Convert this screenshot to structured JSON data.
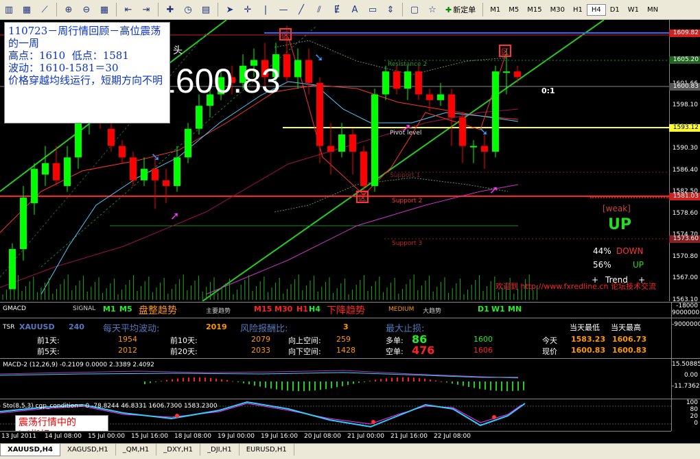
{
  "toolbar": {
    "new_order": "新定单",
    "timeframes": [
      "M1",
      "M5",
      "M15",
      "M30",
      "H1",
      "H4",
      "D1",
      "W1",
      "MN"
    ],
    "active_tf": "H4"
  },
  "note": {
    "text": "110723－周行情回顾－高位震荡的一周\n高点：1610  低点：1581\n波动：1610-1581＝30\n价格穿越均线运行，短期方向不明"
  },
  "chart": {
    "big_price": "1600.83",
    "big_prefix_glyph": "头",
    "ratio": "0:1",
    "levels": {
      "resistance2": "Resistance 2",
      "pivot": "Pivot level",
      "support1": "Support 1",
      "support2": "Support 2",
      "support3": "Support 3"
    },
    "axis_ticks": [
      "1605.20",
      "1601.66",
      "1598.10",
      "1594.20",
      "1590.30",
      "1586.40",
      "1582.50",
      "1578.60",
      "1574.70",
      "1570.80",
      "1567.00",
      "1563.10"
    ],
    "tags": {
      "t1": "1609.82",
      "t2": "1605.20",
      "t3": "1600.83",
      "t4": "1593.12",
      "t5": "1581.03",
      "t6": "1573.60"
    },
    "trend": {
      "weak": "[weak]",
      "up": "UP",
      "down_pct": "44%",
      "down_label": "DOWN",
      "up_pct": "56%",
      "up_label": "UP",
      "trend_label": "Trend",
      "plus": "+"
    },
    "ad": "欢迎到 http://www.fxredline.cn 论坛技术交流"
  },
  "chart_data": {
    "type": "candlestick",
    "symbol": "XAUUSD",
    "timeframe": "H4",
    "ylim": [
      1563.1,
      1609.8
    ],
    "candles": [
      [
        1564,
        1571,
        1564,
        1572
      ],
      [
        1571,
        1580,
        1569,
        1582
      ],
      [
        1579,
        1585,
        1577,
        1586
      ],
      [
        1584,
        1586,
        1582,
        1589
      ],
      [
        1586,
        1583,
        1582,
        1589
      ],
      [
        1582,
        1587,
        1581,
        1589
      ],
      [
        1587,
        1593,
        1585,
        1594
      ],
      [
        1593,
        1595,
        1591,
        1597
      ],
      [
        1595,
        1593,
        1592,
        1596
      ],
      [
        1592,
        1589,
        1588,
        1595
      ],
      [
        1589,
        1587,
        1586,
        1590
      ],
      [
        1587,
        1583,
        1582,
        1588
      ],
      [
        1583,
        1585,
        1582,
        1587
      ],
      [
        1585,
        1583,
        1578,
        1587
      ],
      [
        1583,
        1582,
        1579,
        1585
      ],
      [
        1582,
        1587,
        1581,
        1589
      ],
      [
        1587,
        1592,
        1586,
        1593
      ],
      [
        1592,
        1596,
        1591,
        1598
      ],
      [
        1596,
        1598,
        1594,
        1600
      ],
      [
        1598,
        1601,
        1597,
        1602
      ],
      [
        1601,
        1600,
        1598,
        1603
      ],
      [
        1600,
        1603,
        1599,
        1605
      ],
      [
        1603,
        1604,
        1601,
        1606
      ],
      [
        1604,
        1601,
        1599,
        1607
      ],
      [
        1601,
        1605,
        1600,
        1607
      ],
      [
        1605,
        1601,
        1600,
        1610
      ],
      [
        1601,
        1604,
        1599,
        1606
      ],
      [
        1604,
        1600,
        1598,
        1606
      ],
      [
        1600,
        1589,
        1586,
        1601
      ],
      [
        1589,
        1588,
        1584,
        1593
      ],
      [
        1588,
        1591,
        1587,
        1593
      ],
      [
        1591,
        1588,
        1584,
        1592
      ],
      [
        1588,
        1582,
        1580,
        1589
      ],
      [
        1582,
        1598,
        1581,
        1599
      ],
      [
        1598,
        1602,
        1597,
        1603
      ],
      [
        1602,
        1599,
        1598,
        1603
      ],
      [
        1599,
        1602,
        1597,
        1603
      ],
      [
        1602,
        1598,
        1597,
        1603
      ],
      [
        1598,
        1597,
        1595,
        1599
      ],
      [
        1597,
        1598,
        1596,
        1600
      ],
      [
        1598,
        1594,
        1589,
        1599
      ],
      [
        1594,
        1589,
        1586,
        1595
      ],
      [
        1589,
        1589,
        1586,
        1590
      ],
      [
        1589,
        1588,
        1585,
        1591
      ],
      [
        1588,
        1602,
        1587,
        1603
      ],
      [
        1602,
        1602,
        1598,
        1606
      ],
      [
        1602,
        1601,
        1600,
        1603
      ]
    ]
  },
  "panels": {
    "gmacd": {
      "title": "GMACD",
      "signal": "SIGNAL",
      "m1": "M1",
      "m5": "M5",
      "consolidation": "盘整趋势",
      "main_trend": "主要趋势",
      "m15": "M15",
      "m30": "M30",
      "h1": "H1",
      "h4": "H4",
      "downtrend": "下降趋势",
      "medium": "MEDIUM",
      "big_trend": "大趋势",
      "d1": "D1",
      "w1": "W1",
      "mn": "MN",
      "axis": [
        "-18000",
        "9000000"
      ]
    },
    "tsr": {
      "title": "TSR",
      "symbol": "XAUUSD",
      "period": "240",
      "daily_vol_label": "每天平均波动:",
      "daily_vol": "2019",
      "rr_label": "风险报酬比:",
      "rr": "3",
      "max_stop_label": "最大止损:",
      "today_low_label": "当天最低",
      "today_high_label": "当天最高",
      "d1_label": "前1天:",
      "d1": "1954",
      "d10_label": "前10天:",
      "d10": "2079",
      "up_space_label": "向上空间:",
      "up_space": "259",
      "long_label": "多单:",
      "long_stop": "86",
      "long_price": "1600",
      "today_label": "今天",
      "today_low": "1583.23",
      "today_high": "1606.73",
      "d5_label": "前5天:",
      "d5": "2012",
      "d20_label": "前20天:",
      "d20": "2033",
      "down_space_label": "向下空间:",
      "down_space": "1428",
      "short_label": "空单:",
      "short_stop": "476",
      "short_price": "1606",
      "now_label": "现价",
      "now_low": "1600.83",
      "now_high": "1600.83",
      "axis": "-9000000"
    },
    "macd": {
      "title": "MACD-2 (12,26,9) -0.2109 0.0000 2.3389 2.4092",
      "axis": [
        "15.50885",
        "0.00",
        "-11.7362"
      ]
    },
    "sto": {
      "title": "Sto(8,5,3) cgp_condition= 0 -78.8244 46.8331 1606.7300 1583.2300",
      "axis": [
        "100",
        "80",
        "20",
        "0"
      ]
    }
  },
  "xaxis": [
    "13 Jul 2011",
    "14 Jul 08:00",
    "15 Jul 00:00",
    "15 Jul 16:00",
    "18 Jul 08:00",
    "19 Jul 00:00",
    "19 Jul 16:00",
    "20 Jul 08:00",
    "21 Jul 00:00",
    "21 Jul 16:00",
    "22 Jul 08:00"
  ],
  "kd_note": {
    "text": "震荡行情中的\nkd指标"
  },
  "tabs": [
    "XAUUSD,H4",
    "XAGUSD,H1",
    "_QM,H1",
    "_DXY,H1",
    "_DJI,H1",
    "EURUSD,H1"
  ],
  "colors": {
    "bull": "#00ff00",
    "bear": "#ff0000",
    "tsr_cyan": "#00ffff",
    "resistance": "#3366ff"
  }
}
